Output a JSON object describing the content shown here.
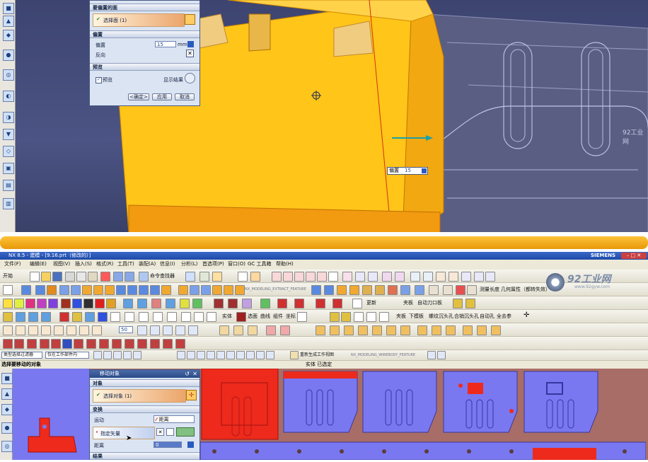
{
  "top_panel": {
    "dialog": {
      "header": "要偏置的面",
      "select_face_label": "选择面 (1)",
      "offset_section": "偏置",
      "offset_label": "偏置",
      "offset_value": "15",
      "unit": "mm",
      "reverse_label": "反向",
      "preview_section": "预览",
      "preview_label": "预览",
      "show_result_label": "显示结果",
      "ok_label": "<确定>",
      "apply_label": "应用",
      "cancel_label": "取消"
    },
    "floating_input": {
      "label": "偏置",
      "value": "15"
    },
    "watermark": "92工业网"
  },
  "nx": {
    "title": "NX 8.5 - 建模 - [9.16.prt（修改的）]",
    "brand": "SIEMENS",
    "menu": [
      "文件(F)",
      "编辑(E)",
      "视图(V)",
      "插入(S)",
      "格式(R)",
      "工具(T)",
      "装配(A)",
      "信息(I)",
      "分析(L)",
      "首选项(P)",
      "窗口(O)",
      "GC 工具箱",
      "帮助(H)"
    ],
    "toolbar": {
      "start_label": "开始",
      "command_finder_label": "命令查找器",
      "feature_field": "NX_MODELING_EXTRACT_FEATURE",
      "measure_length": "测量长度",
      "geometry_props": "几何属性（都转失效）",
      "solid_label": "实体",
      "select_face": "选面",
      "curve": "曲线",
      "component": "组件",
      "coordinate": "坐标",
      "update": "更新",
      "template": "夹板",
      "auto_edge": "自动刀口板",
      "plate": "夹板",
      "lower_template": "下模板",
      "thread_hole": "螺纹沉头孔",
      "pin_hole": "合销沉头孔",
      "auto_hole": "自动孔",
      "all_parts": "全去参",
      "zoom_value": "50",
      "filter_label": "类型选择过滤器",
      "scope_label": "仅在工作部件内",
      "regen_label": "重新生成工作视图",
      "feature_field2": "NX_MODELING_WIREBODY_FEATURE"
    },
    "status": {
      "prompt": "选择要移动的对象",
      "selection": "实体 已选定"
    },
    "logo": {
      "main": "92工业网",
      "sub": "www.92gyw.com"
    },
    "move_dialog": {
      "title": "移动对象",
      "objects_section": "对象",
      "select_object": "选择对象 (1)",
      "transform_section": "变换",
      "motion_label": "运动",
      "motion_value": "距离",
      "vector_label": "指定矢量",
      "distance_label": "距离",
      "distance_value": "0",
      "result_section": "结果"
    }
  },
  "colors": {
    "accent_orange": "#f6b112",
    "part_yellow": "#ffc519",
    "part_blue": "#7a78f0",
    "part_red": "#ee2a1c",
    "titlebar_blue": "#1e4aa8"
  }
}
